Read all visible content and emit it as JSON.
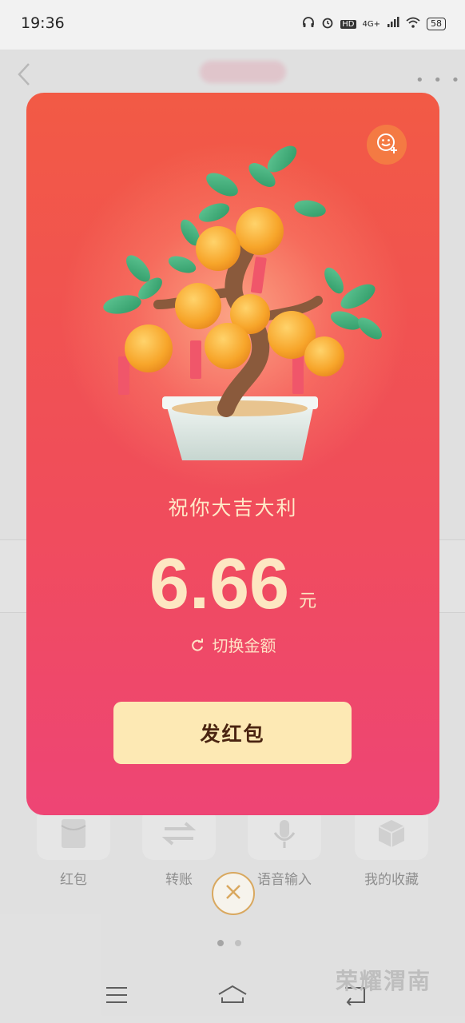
{
  "status_bar": {
    "time": "19:36",
    "hd_label": "HD",
    "network_label": "4G+",
    "battery": "58"
  },
  "red_packet": {
    "blessing": "祝你大吉大利",
    "amount": "6.66",
    "unit": "元",
    "switch_label": "切换金额",
    "send_label": "发红包"
  },
  "tools": [
    {
      "label": "红包",
      "icon": "red-packet-icon"
    },
    {
      "label": "转账",
      "icon": "transfer-icon"
    },
    {
      "label": "语音输入",
      "icon": "microphone-icon"
    },
    {
      "label": "我的收藏",
      "icon": "favorites-cube-icon"
    }
  ],
  "watermark": "荣耀渭南",
  "colors": {
    "card_top": "#f25a45",
    "card_bottom": "#ee4575",
    "amount_text": "#fde7c2",
    "send_button_bg": "#fde9b4",
    "close_ring": "#d9a85f"
  }
}
